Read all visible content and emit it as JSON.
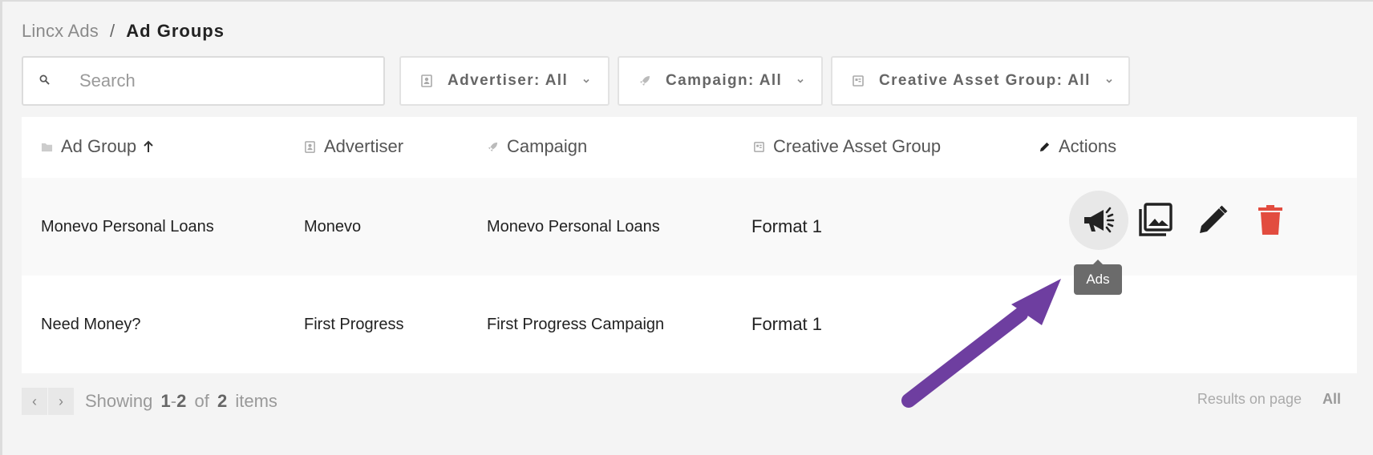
{
  "breadcrumb": {
    "root": "Lincx Ads",
    "separator": "/",
    "current": "Ad Groups"
  },
  "search": {
    "placeholder": "Search",
    "value": ""
  },
  "filters": [
    {
      "label": "Advertiser: All",
      "icon": "advertiser-icon"
    },
    {
      "label": "Campaign: All",
      "icon": "rocket-icon"
    },
    {
      "label": "Creative Asset Group: All",
      "icon": "asset-group-icon"
    }
  ],
  "table": {
    "columns": [
      {
        "label": "Ad Group",
        "icon": "folder-icon",
        "sort": "asc"
      },
      {
        "label": "Advertiser",
        "icon": "advertiser-icon"
      },
      {
        "label": "Campaign",
        "icon": "rocket-icon"
      },
      {
        "label": "Creative Asset Group",
        "icon": "asset-group-icon"
      },
      {
        "label": "Actions",
        "icon": "pencil-icon"
      }
    ],
    "rows": [
      {
        "ad_group": "Monevo Personal Loans",
        "advertiser": "Monevo",
        "campaign": "Monevo Personal Loans",
        "creative_asset_group": "Format 1"
      },
      {
        "ad_group": "Need Money?",
        "advertiser": "First Progress",
        "campaign": "First Progress Campaign",
        "creative_asset_group": "Format 1"
      }
    ]
  },
  "actions": {
    "icons": [
      "megaphone-icon",
      "gallery-icon",
      "edit-icon",
      "trash-icon"
    ],
    "tooltip": "Ads"
  },
  "pagination": {
    "prev": "‹",
    "next": "›",
    "showing_label": "Showing",
    "range_start": "1",
    "range_sep": "-",
    "range_end": "2",
    "of_label": "of",
    "total": "2",
    "items_label": "items",
    "results_label": "Results on page",
    "results_value": "All"
  },
  "colors": {
    "delete": "#e24c3f",
    "annotation_arrow": "#6e3ea0"
  }
}
